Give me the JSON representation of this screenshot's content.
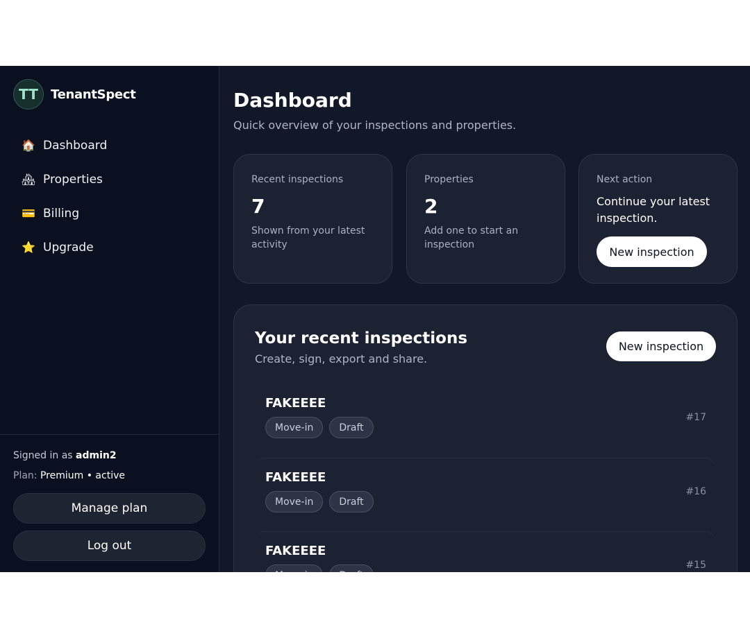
{
  "brand": {
    "logo_text": "TT",
    "name": "TenantSpect"
  },
  "nav": [
    {
      "icon": "🏠",
      "icon_name": "house-icon",
      "label": "Dashboard"
    },
    {
      "icon": "🏘",
      "icon_name": "houses-icon",
      "label": "Properties"
    },
    {
      "icon": "💳",
      "icon_name": "credit-card-icon",
      "label": "Billing"
    },
    {
      "icon": "⭐",
      "icon_name": "star-icon",
      "label": "Upgrade"
    }
  ],
  "account": {
    "signed_prefix": "Signed in as ",
    "username": "admin2",
    "plan_prefix": "Plan: ",
    "plan_name": "Premium",
    "plan_sep": " • ",
    "plan_status": "active",
    "manage_label": "Manage plan",
    "logout_label": "Log out"
  },
  "header": {
    "title": "Dashboard",
    "subtitle": "Quick overview of your inspections and properties."
  },
  "cards": {
    "recent": {
      "label": "Recent inspections",
      "value": "7",
      "sub": "Shown from your latest activity"
    },
    "properties": {
      "label": "Properties",
      "value": "2",
      "sub": "Add one to start an inspection"
    },
    "next": {
      "label": "Next action",
      "text": "Continue your latest inspection.",
      "button": "New inspection"
    }
  },
  "recent_panel": {
    "title": "Your recent inspections",
    "subtitle": "Create, sign, export and share.",
    "button": "New inspection",
    "rows": [
      {
        "title": "FAKEEEE",
        "tags": [
          "Move-in",
          "Draft"
        ],
        "number": "#17"
      },
      {
        "title": "FAKEEEE",
        "tags": [
          "Move-in",
          "Draft"
        ],
        "number": "#16"
      },
      {
        "title": "FAKEEEE",
        "tags": [
          "Move-in",
          "Draft"
        ],
        "number": "#15"
      }
    ]
  },
  "colors": {
    "sidebar_bg": "#0b1020",
    "main_bg": "#131829",
    "card_bg": "#1d2233",
    "accent": "#9fe3cf",
    "button_bg": "#ffffff"
  }
}
